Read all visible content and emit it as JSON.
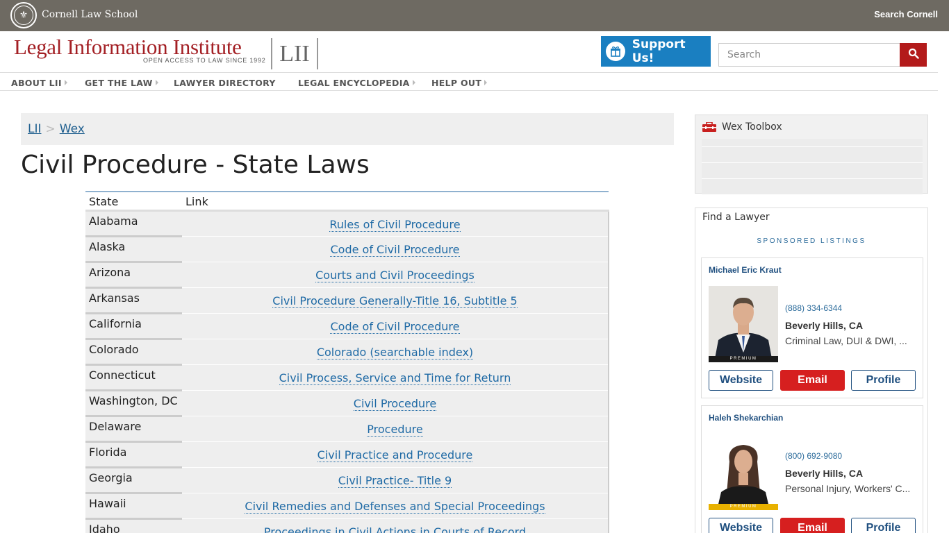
{
  "topbar": {
    "institution": "Cornell Law School",
    "search_link": "Search Cornell"
  },
  "header": {
    "title": "Legal Information Institute",
    "tagline": "OPEN ACCESS TO LAW SINCE 1992",
    "logo_mark": "LII",
    "support_label": "Support Us!",
    "search_placeholder": "Search"
  },
  "nav": {
    "items": [
      {
        "label": "ABOUT LII",
        "has_menu": true
      },
      {
        "label": "GET THE LAW",
        "has_menu": true
      },
      {
        "label": "LAWYER DIRECTORY",
        "has_menu": false
      },
      {
        "label": "LEGAL ENCYCLOPEDIA",
        "has_menu": true
      },
      {
        "label": "HELP OUT",
        "has_menu": true
      }
    ]
  },
  "breadcrumb": {
    "items": [
      "LII",
      "Wex"
    ],
    "separator": ">"
  },
  "page": {
    "title": "Civil Procedure - State Laws"
  },
  "table": {
    "headers": [
      "State",
      "Link"
    ],
    "rows": [
      {
        "state": "Alabama",
        "link": "Rules of Civil Procedure"
      },
      {
        "state": "Alaska",
        "link": "Code of Civil Procedure"
      },
      {
        "state": "Arizona",
        "link": "Courts and Civil Proceedings"
      },
      {
        "state": "Arkansas",
        "link": "Civil Procedure Generally-Title 16, Subtitle 5"
      },
      {
        "state": "California",
        "link": "Code of Civil Procedure"
      },
      {
        "state": "Colorado",
        "link": "Colorado (searchable index)"
      },
      {
        "state": "Connecticut",
        "link": "Civil Process, Service and Time for Return"
      },
      {
        "state": "Washington, DC",
        "link": "Civil Procedure"
      },
      {
        "state": "Delaware",
        "link": "Procedure"
      },
      {
        "state": "Florida",
        "link": "Civil Practice and Procedure"
      },
      {
        "state": "Georgia",
        "link": "Civil Practice- Title 9"
      },
      {
        "state": "Hawaii",
        "link": "Civil Remedies and Defenses and Special Proceedings"
      },
      {
        "state": "Idaho",
        "link": "Proceedings in Civil Actions in Courts of Record"
      }
    ]
  },
  "sidebar": {
    "toolbox_title": "Wex Toolbox",
    "find_lawyer_title": "Find a Lawyer",
    "sponsored_label": "SPONSORED LISTINGS",
    "premium_label": "PREMIUM",
    "lawyers": [
      {
        "name": "Michael Eric Kraut",
        "phone": "(888) 334-6344",
        "location": "Beverly Hills, CA",
        "practice": "Criminal Law, DUI & DWI, ...",
        "premium_color": "#1a1a1a",
        "buttons": {
          "website": "Website",
          "email": "Email",
          "profile": "Profile"
        }
      },
      {
        "name": "Haleh Shekarchian",
        "phone": "(800) 692-9080",
        "location": "Beverly Hills, CA",
        "practice": "Personal Injury, Workers' C...",
        "premium_color": "#e8b100",
        "buttons": {
          "website": "Website",
          "email": "Email",
          "profile": "Profile"
        }
      }
    ]
  },
  "colors": {
    "brand_red": "#a31f24",
    "support_blue": "#1a7fc1",
    "link_blue": "#1f6aa5",
    "email_red": "#d61f1f"
  }
}
